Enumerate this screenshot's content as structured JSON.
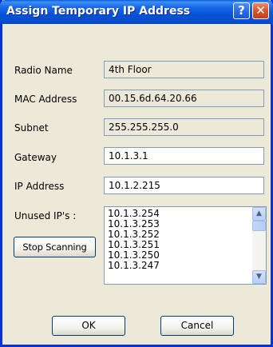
{
  "window": {
    "title": "Assign Temporary IP Address",
    "help_glyph": "?",
    "close_glyph": "✕"
  },
  "form": {
    "radio_name": {
      "label": "Radio Name",
      "value": "4th Floor"
    },
    "mac_address": {
      "label": "MAC Address",
      "value": "00.15.6d.64.20.66"
    },
    "subnet": {
      "label": "Subnet",
      "value": "255.255.255.0"
    },
    "gateway": {
      "label": "Gateway",
      "value": "10.1.3.1"
    },
    "ip_address": {
      "label": "IP Address",
      "value": "10.1.2.215"
    },
    "unused_ips": {
      "label": "Unused IP's :",
      "items": [
        "10.1.3.254",
        "10.1.3.253",
        "10.1.3.252",
        "10.1.3.251",
        "10.1.3.250",
        "10.1.3.247"
      ]
    }
  },
  "buttons": {
    "stop_scanning": "Stop Scanning",
    "ok": "OK",
    "cancel": "Cancel"
  },
  "scrollbar": {
    "up_glyph": "▲",
    "down_glyph": "▼"
  },
  "colors": {
    "titlebar": "#0a5fd8",
    "window_bg": "#ece9d8",
    "close_button": "#d9542f",
    "field_border": "#7f9db9"
  }
}
